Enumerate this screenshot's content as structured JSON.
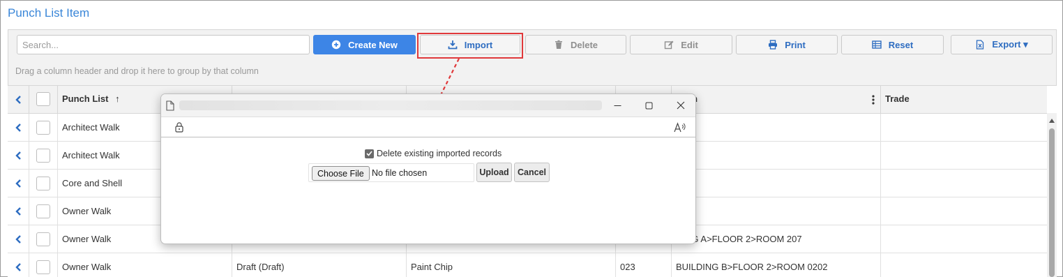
{
  "page": {
    "title": "Punch List Item"
  },
  "toolbar": {
    "search_placeholder": "Search...",
    "create_new": "Create New",
    "import": "Import",
    "delete": "Delete",
    "edit": "Edit",
    "print": "Print",
    "reset": "Reset",
    "export": "Export ▾"
  },
  "grouping_hint": "Drag a column header and drop it here to group by that column",
  "grid": {
    "columns": [
      "Punch List",
      "",
      "",
      "",
      "ation",
      "Trade"
    ],
    "sort_indicator": "↑",
    "rows": [
      {
        "punch_list": "Architect Walk",
        "status": "",
        "type": "",
        "code": "",
        "location": "",
        "trade": ""
      },
      {
        "punch_list": "Architect Walk",
        "status": "",
        "type": "",
        "code": "",
        "location": "",
        "trade": ""
      },
      {
        "punch_list": "Core and Shell",
        "status": "",
        "type": "",
        "code": "",
        "location": "",
        "trade": ""
      },
      {
        "punch_list": "Owner Walk",
        "status": "",
        "type": "",
        "code": "",
        "location": "",
        "trade": ""
      },
      {
        "punch_list": "Owner Walk",
        "status": "",
        "type": "",
        "code": "",
        "location": "DING A>FLOOR 2>ROOM 207",
        "trade": ""
      },
      {
        "punch_list": "Owner Walk",
        "status": "Draft (Draft)",
        "type": "Paint Chip",
        "code": "023",
        "location": "BUILDING B>FLOOR 2>ROOM 0202",
        "trade": ""
      }
    ]
  },
  "dialog": {
    "delete_existing_label": "Delete existing imported records",
    "delete_existing_checked": true,
    "choose_file": "Choose File",
    "no_file": "No file chosen",
    "upload": "Upload",
    "cancel": "Cancel"
  },
  "colors": {
    "accent": "#3d85e6",
    "title": "#3a86d8",
    "highlight": "#e0393b",
    "annotation_arrow": "#e0393b"
  }
}
